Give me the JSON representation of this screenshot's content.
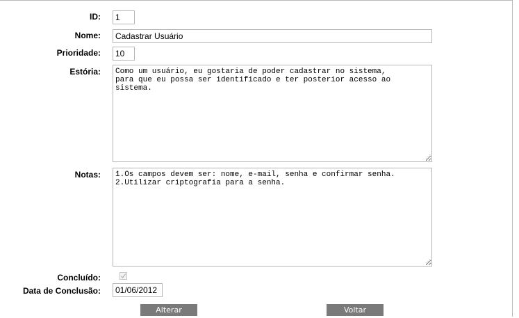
{
  "form": {
    "id": {
      "label": "ID:",
      "value": "1"
    },
    "nome": {
      "label": "Nome:",
      "value": "Cadastrar Usuário"
    },
    "prioridade": {
      "label": "Prioridade:",
      "value": "10"
    },
    "estoria": {
      "label": "Estória:",
      "value": "Como um usuário, eu gostaria de poder cadastrar no sistema,\npara que eu possa ser identificado e ter posterior acesso ao\nsistema."
    },
    "notas": {
      "label": "Notas:",
      "value": "1.Os campos devem ser: nome, e-mail, senha e confirmar senha.\n2.Utilizar criptografia para a senha."
    },
    "concluido": {
      "label": "Concluído:",
      "checked": true,
      "disabled": true
    },
    "data_conclusao": {
      "label": "Data de Conclusão:",
      "value": "01/06/2012"
    }
  },
  "buttons": {
    "alterar": "Alterar",
    "voltar": "Voltar"
  },
  "colors": {
    "button_bg": "#7a7a7a",
    "border": "#b5b5b5"
  }
}
